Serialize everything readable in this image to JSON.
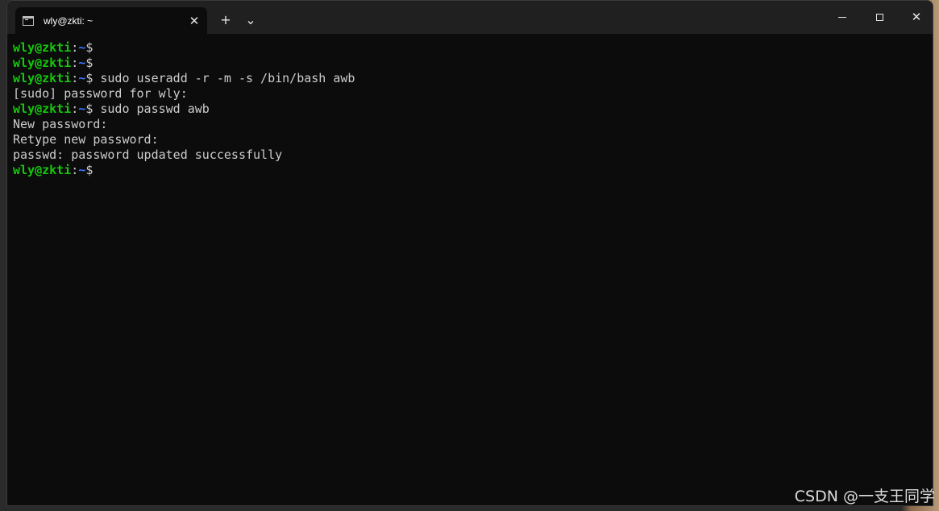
{
  "window": {
    "tab_title": "wly@zkti: ~",
    "tab_close": "✕",
    "new_tab": "+",
    "dropdown": "⌄",
    "close_glyph": "✕"
  },
  "terminal": {
    "lines": [
      {
        "type": "prompt",
        "user": "wly@zkti",
        "sep": ":",
        "path": "~",
        "symbol": "$",
        "cmd": ""
      },
      {
        "type": "prompt",
        "user": "wly@zkti",
        "sep": ":",
        "path": "~",
        "symbol": "$",
        "cmd": ""
      },
      {
        "type": "prompt",
        "user": "wly@zkti",
        "sep": ":",
        "path": "~",
        "symbol": "$",
        "cmd": " sudo useradd -r -m -s /bin/bash awb"
      },
      {
        "type": "output",
        "text": "[sudo] password for wly:"
      },
      {
        "type": "prompt",
        "user": "wly@zkti",
        "sep": ":",
        "path": "~",
        "symbol": "$",
        "cmd": " sudo passwd awb"
      },
      {
        "type": "output",
        "text": "New password:"
      },
      {
        "type": "output",
        "text": "Retype new password:"
      },
      {
        "type": "output",
        "text": "passwd: password updated successfully"
      },
      {
        "type": "prompt",
        "user": "wly@zkti",
        "sep": ":",
        "path": "~",
        "symbol": "$",
        "cmd": ""
      }
    ]
  },
  "watermark": "CSDN @一支王同学",
  "colors": {
    "user": "#16c60c",
    "path": "#3b78ff",
    "text": "#cccccc",
    "background": "#0c0c0c",
    "titlebar": "#202020"
  },
  "icons": {
    "tab_icon": "terminal-icon",
    "new_tab": "plus-icon",
    "dropdown": "chevron-down-icon",
    "minimize": "minimize-icon",
    "maximize": "maximize-icon",
    "close": "close-icon"
  }
}
